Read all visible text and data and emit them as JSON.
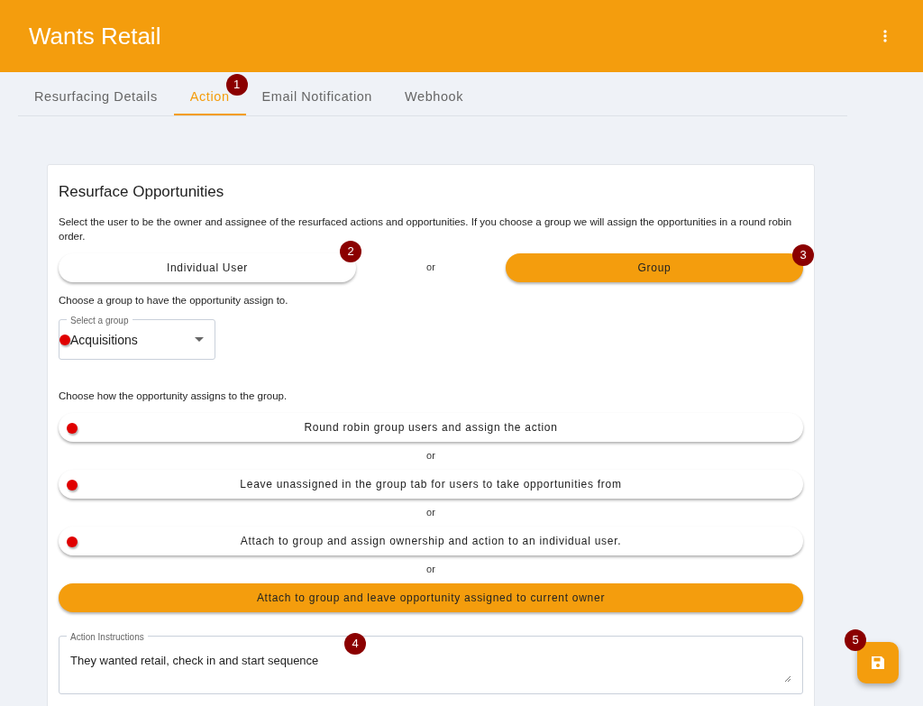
{
  "app_bar": {
    "title": "Wants Retail"
  },
  "tabs": [
    {
      "label": "Resurfacing Details",
      "selected": false
    },
    {
      "label": "Action",
      "selected": true,
      "badge": "1"
    },
    {
      "label": "Email Notification",
      "selected": false
    },
    {
      "label": "Webhook",
      "selected": false
    }
  ],
  "section": {
    "title": "Resurface Opportunities",
    "description": "Select the user to be the owner and assignee of the resurfaced actions and opportunities. If you choose a group we will assign the opportunities in a round robin order.",
    "assignee_options": [
      {
        "label": "Individual User",
        "selected": false,
        "badge": "2"
      },
      {
        "label": "Group",
        "selected": true,
        "badge": "3"
      }
    ],
    "assignee_separator": "or",
    "group_prompt": "Choose a group to have the opportunity assign to.",
    "group_select": {
      "label": "Select a group",
      "value": "Acquisitions",
      "marked": true
    },
    "assign_prompt": "Choose how the opportunity assigns to the group.",
    "assign_options": [
      {
        "label": "Round robin group users and assign the action",
        "selected": false,
        "marked": true
      },
      {
        "label": "Leave unassigned in the group tab for users to take opportunities from",
        "selected": false,
        "marked": true
      },
      {
        "label": "Attach to group and assign ownership and action to an individual user.",
        "selected": false,
        "marked": true
      },
      {
        "label": "Attach to group and leave opportunity assigned to current owner",
        "selected": true,
        "marked": false
      }
    ],
    "assign_separators": [
      "or",
      "or",
      "or"
    ],
    "instructions": {
      "label": "Action Instructions",
      "value": "They wanted retail, check in and start sequence",
      "badge": "4"
    }
  },
  "save_button": {
    "badge": "5"
  }
}
